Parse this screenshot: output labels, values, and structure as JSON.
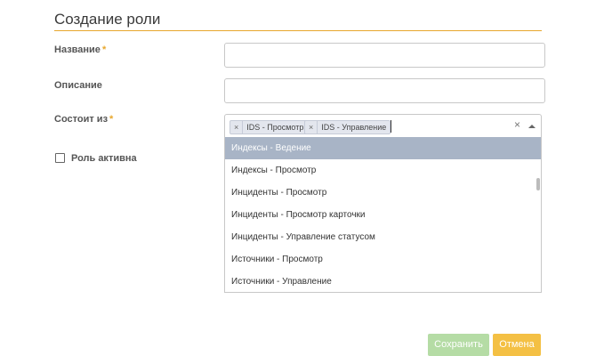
{
  "form": {
    "title": "Создание роли",
    "name_label": "Название",
    "description_label": "Описание",
    "consists_label": "Состоит из",
    "required_mark": "*",
    "name_value": "",
    "description_value": ""
  },
  "multiselect": {
    "selected": [
      "IDS - Просмотр",
      "IDS - Управление"
    ],
    "remove_glyph": "×",
    "clear_glyph": "×",
    "options": [
      "Индексы - Ведение",
      "Индексы - Просмотр",
      "Инциденты - Просмотр",
      "Инциденты - Просмотр карточки",
      "Инциденты - Управление статусом",
      "Источники - Просмотр",
      "Источники - Управление"
    ],
    "highlighted_index": 0
  },
  "role_active": {
    "label": "Роль активна",
    "checked": false
  },
  "buttons": {
    "save": "Сохранить",
    "cancel": "Отмена"
  },
  "colors": {
    "accent": "#e8a72e",
    "save_bg": "#b5dca5",
    "cancel_bg": "#f4c044",
    "highlight": "#a8b4c6"
  }
}
